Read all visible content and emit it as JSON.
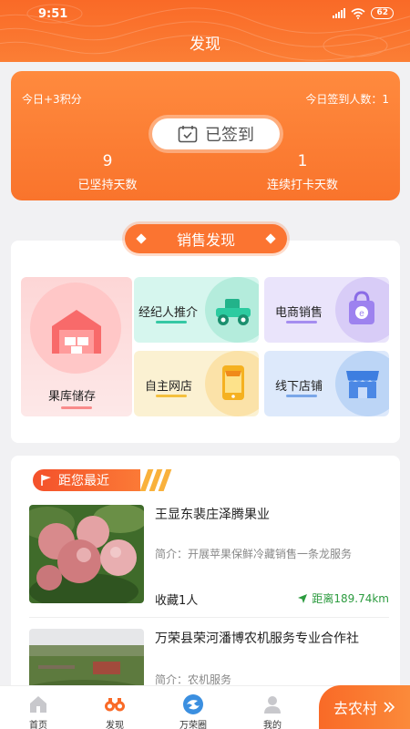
{
  "status_bar": {
    "time": "9:51",
    "battery": "62"
  },
  "header": {
    "title": "发现"
  },
  "checkin": {
    "points_today": "今日+3积分",
    "today_count": "今日签到人数：1",
    "button_label": "已签到",
    "days_kept_value": "9",
    "days_kept_label": "已坚持天数",
    "streak_value": "1",
    "streak_label": "连续打卡天数"
  },
  "sales": {
    "title": "销售发现",
    "tiles": [
      {
        "label": "果库储存",
        "icon": "warehouse-icon"
      },
      {
        "label": "经纪人推介",
        "icon": "tractor-icon"
      },
      {
        "label": "电商销售",
        "icon": "shopping-bag-icon"
      },
      {
        "label": "自主网店",
        "icon": "phone-shop-icon"
      },
      {
        "label": "线下店铺",
        "icon": "storefront-icon"
      }
    ]
  },
  "nearby": {
    "title": "距您最近",
    "items": [
      {
        "name": "王显东裴庄泽腾果业",
        "desc": "简介：开展苹果保鲜冷藏销售一条龙服务",
        "favorites": "收藏1人",
        "distance": "距离189.74km"
      },
      {
        "name": "万荣县荣河潘博农机服务专业合作社",
        "desc": "简介：农机服务"
      }
    ]
  },
  "bottom_nav": {
    "items": [
      {
        "label": "首页",
        "icon": "home-icon"
      },
      {
        "label": "发现",
        "icon": "binoculars-icon"
      },
      {
        "label": "万荣圈",
        "icon": "circle-logo-icon"
      },
      {
        "label": "我的",
        "icon": "profile-icon"
      }
    ],
    "go_village": "去农村"
  },
  "colors": {
    "brand_orange": "#f96a27",
    "distance_green": "#2c9b3f"
  }
}
